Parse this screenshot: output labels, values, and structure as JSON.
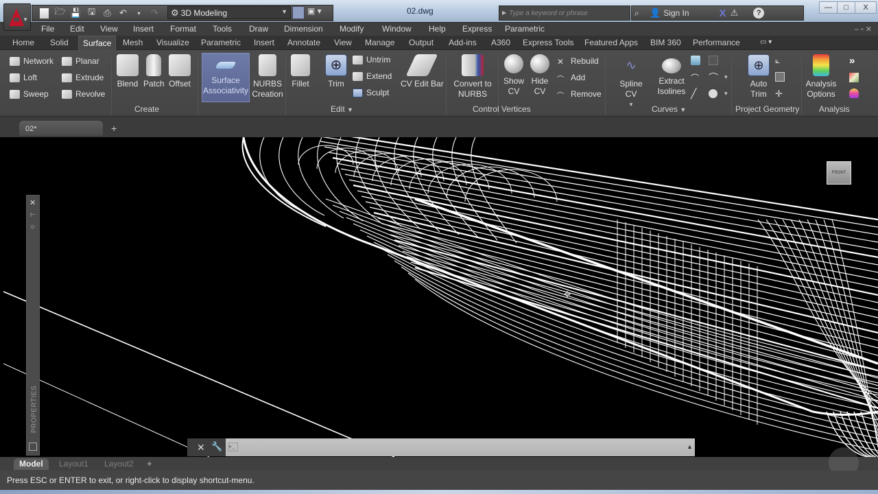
{
  "titlebar": {
    "workspace": "3D Modeling",
    "file_title": "02.dwg",
    "search_placeholder": "Type a keyword or phrase",
    "sign_in": "Sign In"
  },
  "menubar": {
    "items": [
      "File",
      "Edit",
      "View",
      "Insert",
      "Format",
      "Tools",
      "Draw",
      "Dimension",
      "Modify",
      "Window",
      "Help",
      "Express",
      "Parametric"
    ]
  },
  "ribbon_tabs": {
    "items": [
      "Home",
      "Solid",
      "Surface",
      "Mesh",
      "Visualize",
      "Parametric",
      "Insert",
      "Annotate",
      "View",
      "Manage",
      "Output",
      "Add-ins",
      "A360",
      "Express Tools",
      "Featured Apps",
      "BIM 360",
      "Performance"
    ],
    "active": "Surface"
  },
  "ribbon": {
    "create": {
      "title": "Create",
      "small": [
        "Network",
        "Planar",
        "Loft",
        "Extrude",
        "Sweep",
        "Revolve"
      ],
      "large": [
        "Blend",
        "Patch",
        "Offset",
        "Surface Associativity",
        "NURBS Creation"
      ]
    },
    "edit": {
      "title": "Edit",
      "large": [
        "Fillet",
        "Trim"
      ],
      "small": [
        "Untrim",
        "Extend",
        "Sculpt"
      ]
    },
    "control_vertices": {
      "title": "Control Vertices",
      "large": [
        "CV Edit Bar",
        "Convert to NURBS",
        "Show CV",
        "Hide CV"
      ],
      "small": [
        "Rebuild",
        "Add",
        "Remove"
      ]
    },
    "curves": {
      "title": "Curves",
      "large": [
        "Spline CV",
        "Extract Isolines"
      ]
    },
    "project_geometry": {
      "title": "Project Geometry",
      "large": [
        "Auto Trim"
      ]
    },
    "analysis": {
      "title": "Analysis",
      "large": [
        "Analysis Options"
      ]
    }
  },
  "file_tabs": {
    "active": "02*"
  },
  "viewcube": {
    "label": "FRONT"
  },
  "properties_palette": {
    "label": "PROPERTIES"
  },
  "command_line": {
    "value": ""
  },
  "layout_tabs": {
    "items": [
      "Model",
      "Layout1",
      "Layout2"
    ],
    "active": "Model"
  },
  "status": {
    "text": "Press ESC or ENTER to exit, or right-click to display shortcut-menu."
  }
}
